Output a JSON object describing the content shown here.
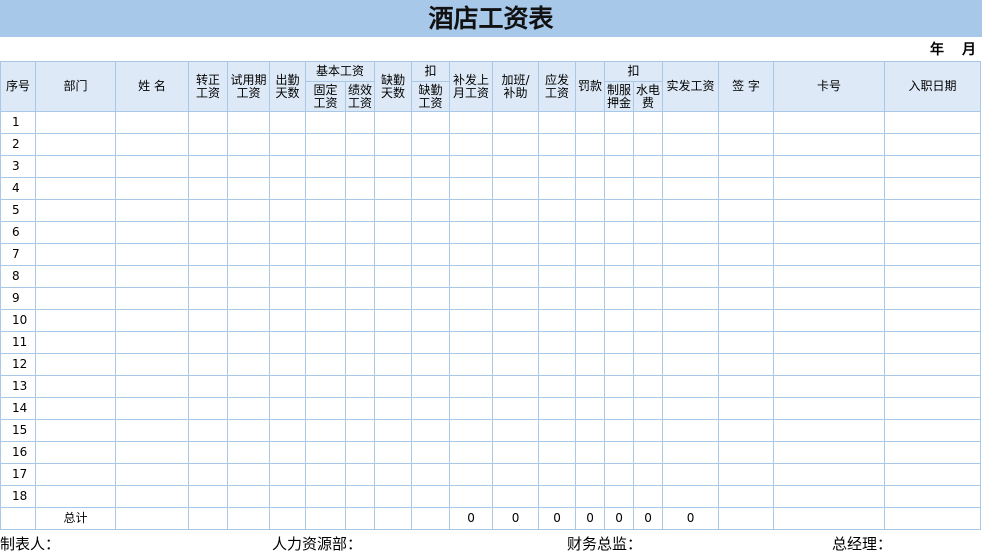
{
  "title": "酒店工资表",
  "date_label": {
    "year": "年",
    "month": "月"
  },
  "headers": {
    "seq": "序号",
    "dept": "部门",
    "name": "姓 名",
    "regular_pay": [
      "转正",
      "工资"
    ],
    "probation_pay": [
      "试用期",
      "工资"
    ],
    "attendance_days": [
      "出勤",
      "天数"
    ],
    "basic_wage": "基本工资",
    "fixed_wage": [
      "固定",
      "工资"
    ],
    "performance_wage": [
      "绩效",
      "工资"
    ],
    "absence_days": [
      "缺勤",
      "天数"
    ],
    "deduct_group_1": "扣",
    "absence_wage": [
      "缺勤",
      "工资"
    ],
    "back_pay": [
      "补发上",
      "月工资"
    ],
    "overtime_subsidy": [
      "加班/",
      "补助"
    ],
    "gross_pay": [
      "应发",
      "工资"
    ],
    "fine": "罚款",
    "deduct_group_2": "扣",
    "uniform_deposit": [
      "制服",
      "押金"
    ],
    "utilities": [
      "水电",
      "费"
    ],
    "net_pay": "实发工资",
    "signature": "签 字",
    "card_no": "卡号",
    "hire_date": "入职日期"
  },
  "rows": [
    "1",
    "2",
    "3",
    "4",
    "5",
    "6",
    "7",
    "8",
    "9",
    "10",
    "11",
    "12",
    "13",
    "14",
    "15",
    "16",
    "17",
    "18"
  ],
  "total": {
    "label": "总计",
    "back_pay": "0",
    "overtime_subsidy": "0",
    "gross_pay": "0",
    "fine": "0",
    "uniform_deposit": "0",
    "utilities": "0",
    "net_pay": "0"
  },
  "footer": {
    "preparer": "制表人：",
    "hr": "人力资源部：",
    "finance": "财务总监：",
    "gm": "总经理："
  },
  "colors": {
    "title_bg": "#a8c8ea",
    "header_bg": "#dde9f6",
    "grid_line": "#a9c7e6"
  }
}
